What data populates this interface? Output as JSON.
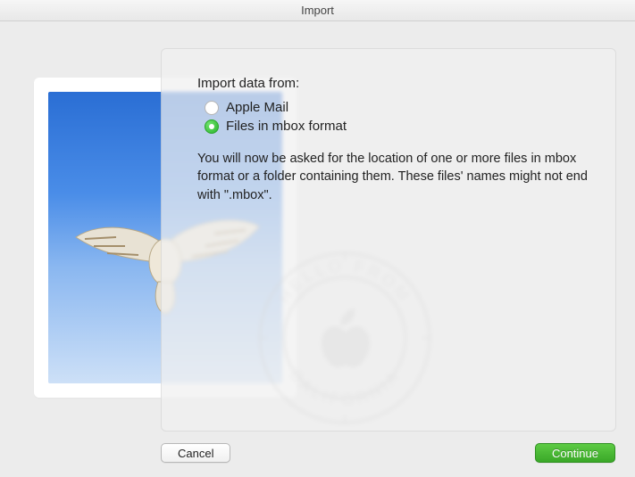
{
  "window": {
    "title": "Import"
  },
  "panel": {
    "heading": "Import data from:",
    "options": [
      {
        "label": "Apple Mail",
        "selected": false
      },
      {
        "label": "Files in mbox format",
        "selected": true
      }
    ],
    "description": "You will now be asked for the location of one or more files in mbox format or a folder containing them. These files' names might not end with \".mbox\"."
  },
  "postmark": {
    "top_text": "HELLO FROM",
    "bottom_text": "CALIFORNIA"
  },
  "buttons": {
    "cancel": "Cancel",
    "continue": "Continue"
  },
  "colors": {
    "accent_green": "#3aa828",
    "window_bg": "#ececec"
  }
}
